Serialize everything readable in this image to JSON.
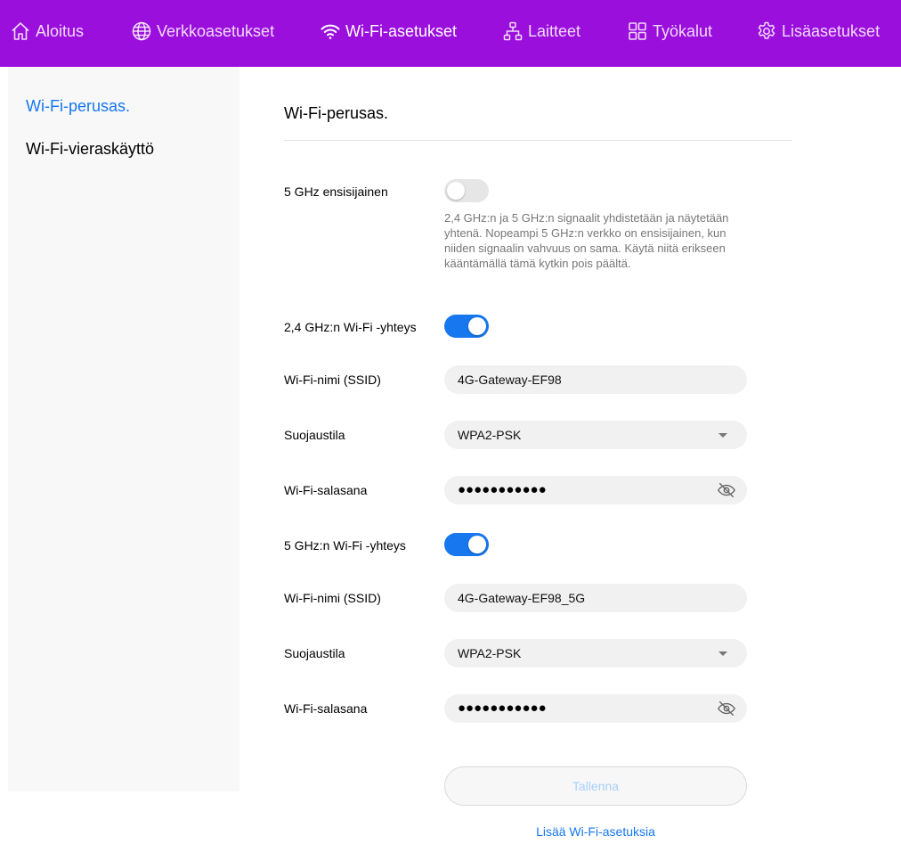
{
  "nav": {
    "items": [
      {
        "label": "Aloitus",
        "icon": "home-icon"
      },
      {
        "label": "Verkkoasetukset",
        "icon": "globe-icon"
      },
      {
        "label": "Wi-Fi-asetukset",
        "icon": "wifi-icon",
        "active": true
      },
      {
        "label": "Laitteet",
        "icon": "network-devices-icon"
      },
      {
        "label": "Työkalut",
        "icon": "tools-grid-icon"
      },
      {
        "label": "Lisäasetukset",
        "icon": "gear-icon"
      }
    ],
    "background": "#9b0fdd"
  },
  "sidebar": {
    "items": [
      {
        "label": "Wi-Fi-perusas.",
        "active": true
      },
      {
        "label": "Wi-Fi-vieraskäyttö",
        "active": false
      }
    ]
  },
  "main": {
    "title": "Wi-Fi-perusas.",
    "band_priority": {
      "label": "5 GHz ensisijainen",
      "enabled": false,
      "description": "2,4 GHz:n ja 5 GHz:n signaalit yhdistetään ja näytetään yhtenä. Nopeampi 5 GHz:n verkko on ensisijainen, kun niiden signaalin vahvuus on sama. Käytä niitä erikseen kääntämällä tämä kytkin pois päältä."
    },
    "wifi_24": {
      "label": "2,4 GHz:n Wi-Fi -yhteys",
      "enabled": true,
      "ssid_label": "Wi-Fi-nimi (SSID)",
      "ssid_value": "4G-Gateway-EF98",
      "security_label": "Suojaustila",
      "security_value": "WPA2-PSK",
      "password_label": "Wi-Fi-salasana",
      "password_mask": "●●●●●●●●●●●"
    },
    "wifi_5": {
      "label": "5 GHz:n Wi-Fi -yhteys",
      "enabled": true,
      "ssid_label": "Wi-Fi-nimi (SSID)",
      "ssid_value": "4G-Gateway-EF98_5G",
      "security_label": "Suojaustila",
      "security_value": "WPA2-PSK",
      "password_label": "Wi-Fi-salasana",
      "password_mask": "●●●●●●●●●●●"
    },
    "save_label": "Tallenna",
    "more_link": "Lisää Wi-Fi-asetuksia"
  },
  "colors": {
    "accent": "#1677ee",
    "nav_bg": "#9b0fdd"
  }
}
